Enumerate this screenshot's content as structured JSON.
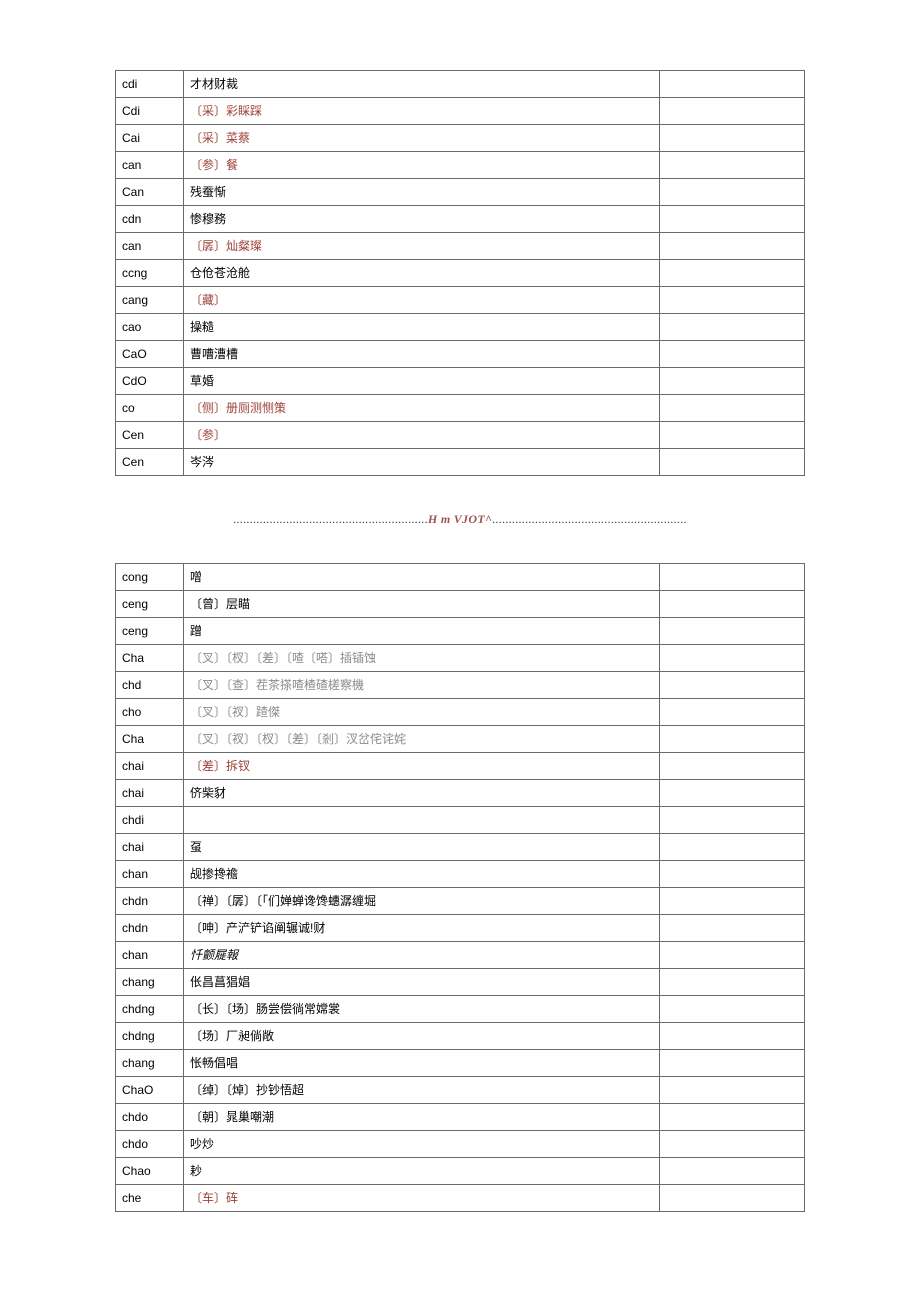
{
  "table1": [
    {
      "c1": "cdi",
      "c2": "才材财裁",
      "cls": ""
    },
    {
      "c1": "Cdi",
      "c2": "〔采〕彩睬踩",
      "cls": "red"
    },
    {
      "c1": "Cai",
      "c2": "〔采〕菜蔡",
      "cls": "red"
    },
    {
      "c1": "can",
      "c2": "〔参〕餐",
      "cls": "red"
    },
    {
      "c1": "Can",
      "c2": "残蚕惭",
      "cls": ""
    },
    {
      "c1": "cdn",
      "c2": "惨穆務",
      "cls": ""
    },
    {
      "c1": "can",
      "c2": "〔孱〕灿粲璨",
      "cls": "red"
    },
    {
      "c1": "ccng",
      "c2": "仓伧苍沧舱",
      "cls": ""
    },
    {
      "c1": "cang",
      "c2": "〔藏〕",
      "cls": "red"
    },
    {
      "c1": "cao",
      "c2": "操糙",
      "cls": ""
    },
    {
      "c1": "CaO",
      "c2": "曹嘈漕槽",
      "cls": ""
    },
    {
      "c1": "CdO",
      "c2": "草婚",
      "cls": ""
    },
    {
      "c1": "co",
      "c2": "〔侧〕册厕测恻策",
      "cls": "red"
    },
    {
      "c1": "Cen",
      "c2": "〔参〕",
      "cls": "red"
    },
    {
      "c1": "Cen",
      "c2": "岑涔",
      "cls": ""
    }
  ],
  "divider": {
    "left": "...........................................................",
    "mid": "H   m VJOT^",
    "right": "..........................................................."
  },
  "table2": [
    {
      "c1": "cong",
      "c2": "噌",
      "cls": ""
    },
    {
      "c1": "ceng",
      "c2": "〔曾〕层瞄",
      "cls": ""
    },
    {
      "c1": "ceng",
      "c2": "蹭",
      "cls": ""
    },
    {
      "c1": "Cha",
      "c2": "〔叉〕〔杈〕〔差〕〔喳〔嗒〕插锸蚀",
      "cls": "gray"
    },
    {
      "c1": "chd",
      "c2": "〔叉〕〔查〕茬茶搽喳楂碴槎察機",
      "cls": "gray"
    },
    {
      "c1": "cho",
      "c2": "〔叉〕〔衩〕蹅傑",
      "cls": "gray"
    },
    {
      "c1": "Cha",
      "c2": "〔叉〕〔衩〕〔杈〕〔差〕〔剎〕汊岔侘诧姹",
      "cls": "gray"
    },
    {
      "c1": "chai",
      "c2": "〔差〕拆钗",
      "cls": "red"
    },
    {
      "c1": "chai",
      "c2": "侪柴豺",
      "cls": ""
    },
    {
      "c1": "chdi",
      "c2": "",
      "cls": ""
    },
    {
      "c1": "chai",
      "c2": "虿",
      "cls": ""
    },
    {
      "c1": "chan",
      "c2": "觇掺搀襜",
      "cls": ""
    },
    {
      "c1": "chdn",
      "c2": "〔禅〕〔孱〕〔「们婵蝉谗馋蟪潺缠堀",
      "cls": ""
    },
    {
      "c1": "chdn",
      "c2": "〔呻〕产浐铲谄阐辗诚!财",
      "cls": ""
    },
    {
      "c1": "chan",
      "c2": "忏颤屣報",
      "cls": "ital"
    },
    {
      "c1": "chang",
      "c2": "伥昌菖猖娼",
      "cls": ""
    },
    {
      "c1": "chdng",
      "c2": "〔长〕〔场〕肠尝偿徜常嫦裳",
      "cls": ""
    },
    {
      "c1": "chdng",
      "c2": "〔场〕厂昶倘敞",
      "cls": ""
    },
    {
      "c1": "chang",
      "c2": "怅畅倡唱",
      "cls": ""
    },
    {
      "c1": "ChaO",
      "c2": "〔绰〕〔焯〕抄钞悟超",
      "cls": ""
    },
    {
      "c1": "chdo",
      "c2": "〔朝〕晁巢嘲潮",
      "cls": ""
    },
    {
      "c1": "chdo",
      "c2": "吵炒",
      "cls": ""
    },
    {
      "c1": "Chao",
      "c2": "耖",
      "cls": ""
    },
    {
      "c1": "che",
      "c2": "〔车〕砗",
      "cls": "red"
    }
  ]
}
